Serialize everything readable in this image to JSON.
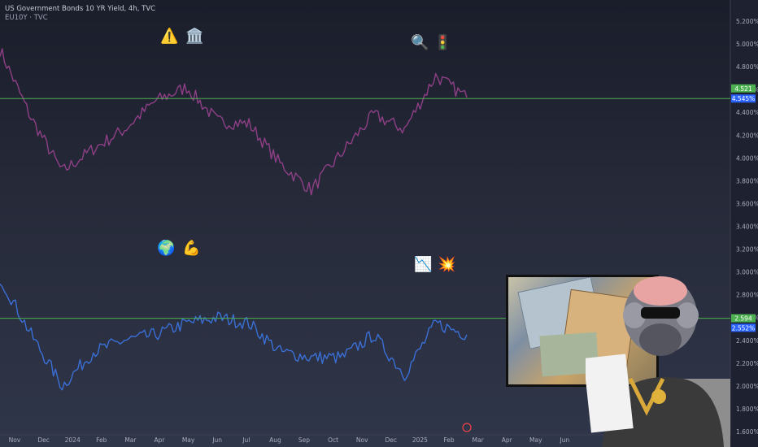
{
  "header": {
    "title": "US Government Bonds 10 YR Yield, 4h, TVC",
    "subtitle": "EU10Y · TVC",
    "unit": "%"
  },
  "price_axis": {
    "ticks": [
      "5.200%",
      "5.000%",
      "4.800%",
      "4.600%",
      "4.400%",
      "4.200%",
      "4.000%",
      "3.800%",
      "3.600%",
      "3.400%",
      "3.200%",
      "3.000%",
      "2.800%",
      "2.600%",
      "2.400%",
      "2.200%",
      "2.000%",
      "1.800%",
      "1.600%"
    ],
    "us_price_label": "4.521",
    "us_last_label": "4.545%",
    "eu_price_label": "2.594",
    "eu_last_label": "2.552%"
  },
  "time_axis": {
    "labels": [
      "Nov",
      "Dec",
      "2024",
      "Feb",
      "Mar",
      "Apr",
      "May",
      "Jun",
      "Jul",
      "Aug",
      "Sep",
      "Oct",
      "Nov",
      "Dec",
      "2025",
      "Feb",
      "Mar",
      "Apr",
      "May",
      "Jun"
    ]
  },
  "icons": {
    "warning": "⚠️",
    "bank": "🏛️",
    "magnifier": "🔍",
    "traffic_light": "🚦",
    "globe": "🌍",
    "muscle": "💪",
    "chart_down": "📉",
    "burst": "💥"
  },
  "colors": {
    "us_line": "#8e3f86",
    "eu_line": "#3a6fd6",
    "hline": "#4caf50",
    "us_last_bg": "#2962ff",
    "eu_last_bg": "#2962ff",
    "price_tag_bg": "#4caf50"
  },
  "chart_data": {
    "type": "line",
    "title": "US Government Bonds 10 YR Yield, 4h, TVC",
    "y_unit": "%",
    "ylim": [
      1.6,
      5.2
    ],
    "x": [
      "Nov",
      "Dec",
      "2024",
      "Feb",
      "Mar",
      "Apr",
      "May",
      "Jun",
      "Jul",
      "Aug",
      "Sep",
      "Oct",
      "Nov",
      "Dec",
      "2025",
      "Feb",
      "Mar"
    ],
    "series": [
      {
        "name": "US10Y",
        "values": [
          4.95,
          4.35,
          3.88,
          4.08,
          4.25,
          4.5,
          4.62,
          4.32,
          4.3,
          3.95,
          3.72,
          4.05,
          4.38,
          4.25,
          4.72,
          4.53,
          null
        ]
      },
      {
        "name": "EU10Y",
        "values": [
          2.95,
          2.45,
          2.0,
          2.3,
          2.4,
          2.45,
          2.55,
          2.6,
          2.55,
          2.3,
          2.25,
          2.25,
          2.45,
          2.1,
          2.55,
          2.45,
          null
        ]
      }
    ],
    "hlines": [
      4.521,
      2.594
    ],
    "grid": false,
    "legend": "none"
  }
}
